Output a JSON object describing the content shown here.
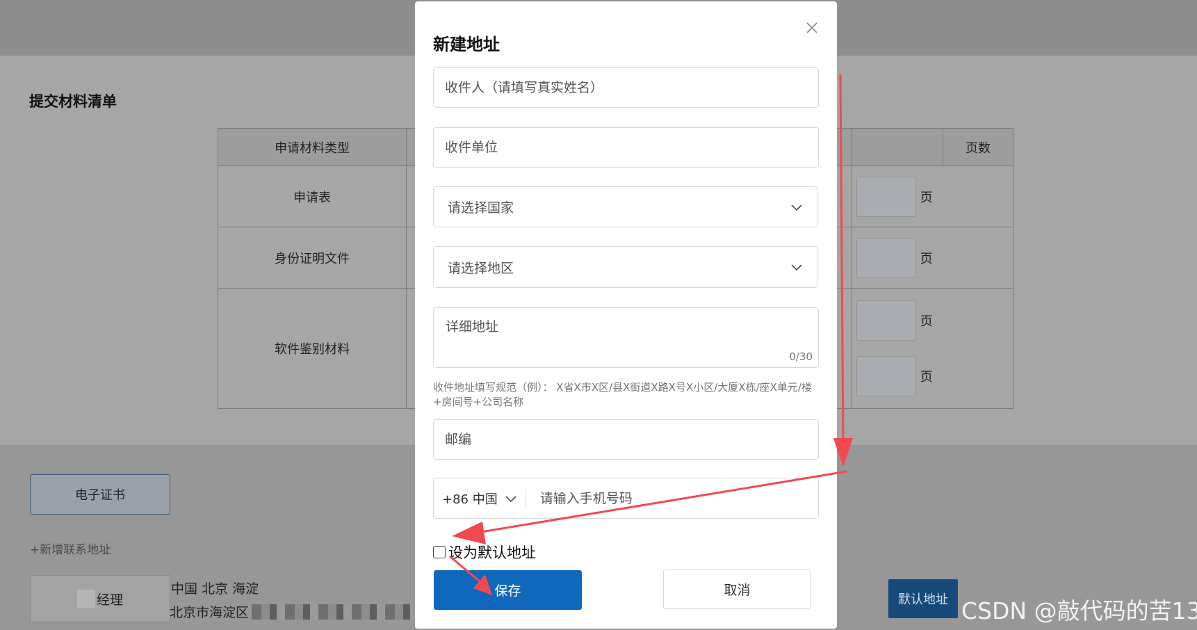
{
  "background": {
    "section_title": "提交材料清单",
    "table": {
      "headers": [
        "申请材料类型",
        "",
        "",
        "页数"
      ],
      "rows": [
        {
          "type": "申请表",
          "unit": "页"
        },
        {
          "type": "身份证明文件",
          "unit": "页"
        },
        {
          "type": "软件鉴别材料",
          "unit": "页",
          "unit2": "页"
        }
      ]
    },
    "ecert_button": "电子证书",
    "add_address": "+新增联系地址",
    "address_card": {
      "name_suffix": "经理",
      "region": "中国 北京 海淀",
      "detail": "北京市海淀区",
      "default_badge": "默认地址"
    },
    "watermark": "CSDN @敲代码的苦13"
  },
  "modal": {
    "title": "新建地址",
    "receiver_placeholder": "收件人（请填写真实姓名）",
    "company_placeholder": "收件单位",
    "country_placeholder": "请选择国家",
    "region_placeholder": "请选择地区",
    "detail_placeholder": "详细地址",
    "detail_counter": "0/30",
    "hint": "收件地址填写规范（例）： X省X市X区/县X街道X路X号X小区/大厦X栋/座X单元/楼+房间号+公司名称",
    "zip_placeholder": "邮编",
    "phone_code": "+86 中国",
    "phone_placeholder": "请输入手机号码",
    "default_checkbox_label": "设为默认地址",
    "default_checked": false,
    "save_label": "保存",
    "cancel_label": "取消"
  },
  "colors": {
    "primary": "#1068bd",
    "annotation_arrow": "#f04a4f"
  }
}
